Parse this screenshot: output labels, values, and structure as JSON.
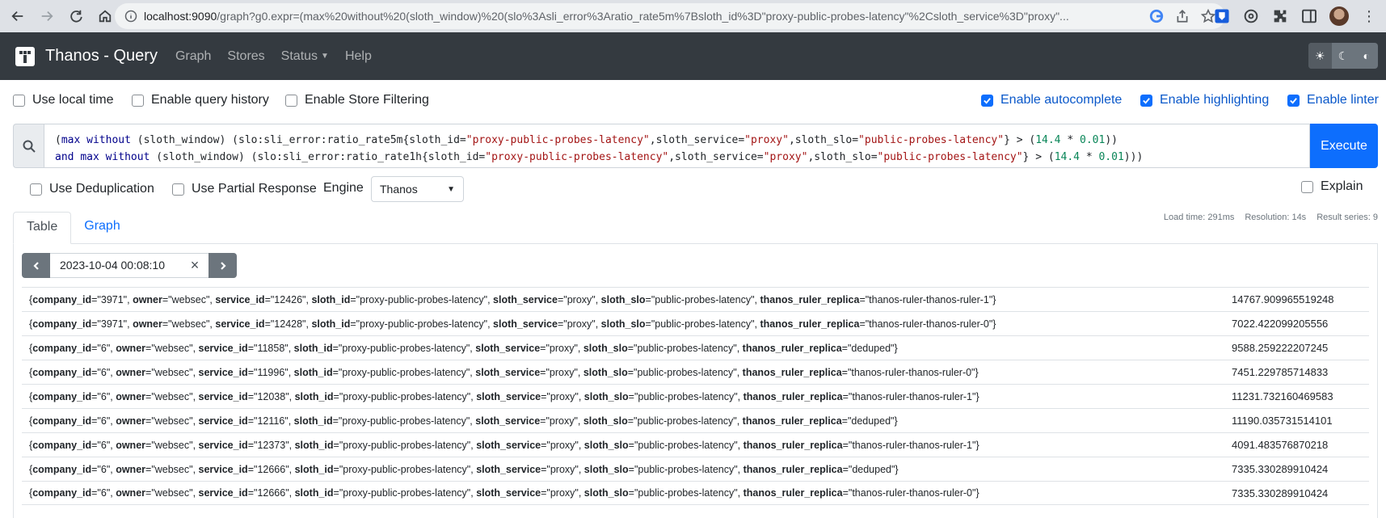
{
  "browser": {
    "url_host": "localhost:9090",
    "url_rest": "/graph?g0.expr=(max%20without%20(sloth_window)%20(slo%3Asli_error%3Aratio_rate5m%7Bsloth_id%3D\"proxy-public-probes-latency\"%2Csloth_service%3D\"proxy\"..."
  },
  "navbar": {
    "brand": "Thanos - Query",
    "links": [
      "Graph",
      "Stores",
      "Status",
      "Help"
    ]
  },
  "options": {
    "use_local_time": "Use local time",
    "enable_query_history": "Enable query history",
    "enable_store_filtering": "Enable Store Filtering",
    "enable_autocomplete": "Enable autocomplete",
    "enable_highlighting": "Enable highlighting",
    "enable_linter": "Enable linter"
  },
  "query": {
    "line1": "(max without (sloth_window) (slo:sli_error:ratio_rate5m{sloth_id=\"proxy-public-probes-latency\",sloth_service=\"proxy\",sloth_slo=\"public-probes-latency\"} > (14.4 * 0.01))",
    "line2": "and max without (sloth_window) (slo:sli_error:ratio_rate1h{sloth_id=\"proxy-public-probes-latency\",sloth_service=\"proxy\",sloth_slo=\"public-probes-latency\"} > (14.4 * 0.01)))",
    "execute_label": "Execute"
  },
  "row2": {
    "use_deduplication": "Use Deduplication",
    "use_partial_response": "Use Partial Response",
    "engine_label": "Engine",
    "engine_value": "Thanos",
    "explain": "Explain"
  },
  "tabs": {
    "table": "Table",
    "graph": "Graph"
  },
  "stats": {
    "load_time": "Load time: 291ms",
    "resolution": "Resolution: 14s",
    "result_series": "Result series: 9"
  },
  "time": {
    "value": "2023-10-04 00:08:10",
    "clear": "×"
  },
  "results": [
    {
      "labels": [
        [
          "company_id",
          "3971"
        ],
        [
          "owner",
          "websec"
        ],
        [
          "service_id",
          "12426"
        ],
        [
          "sloth_id",
          "proxy-public-probes-latency"
        ],
        [
          "sloth_service",
          "proxy"
        ],
        [
          "sloth_slo",
          "public-probes-latency"
        ],
        [
          "thanos_ruler_replica",
          "thanos-ruler-thanos-ruler-1"
        ]
      ],
      "value": "14767.909965519248"
    },
    {
      "labels": [
        [
          "company_id",
          "3971"
        ],
        [
          "owner",
          "websec"
        ],
        [
          "service_id",
          "12428"
        ],
        [
          "sloth_id",
          "proxy-public-probes-latency"
        ],
        [
          "sloth_service",
          "proxy"
        ],
        [
          "sloth_slo",
          "public-probes-latency"
        ],
        [
          "thanos_ruler_replica",
          "thanos-ruler-thanos-ruler-0"
        ]
      ],
      "value": "7022.422099205556"
    },
    {
      "labels": [
        [
          "company_id",
          "6"
        ],
        [
          "owner",
          "websec"
        ],
        [
          "service_id",
          "11858"
        ],
        [
          "sloth_id",
          "proxy-public-probes-latency"
        ],
        [
          "sloth_service",
          "proxy"
        ],
        [
          "sloth_slo",
          "public-probes-latency"
        ],
        [
          "thanos_ruler_replica",
          "deduped"
        ]
      ],
      "value": "9588.259222207245"
    },
    {
      "labels": [
        [
          "company_id",
          "6"
        ],
        [
          "owner",
          "websec"
        ],
        [
          "service_id",
          "11996"
        ],
        [
          "sloth_id",
          "proxy-public-probes-latency"
        ],
        [
          "sloth_service",
          "proxy"
        ],
        [
          "sloth_slo",
          "public-probes-latency"
        ],
        [
          "thanos_ruler_replica",
          "thanos-ruler-thanos-ruler-0"
        ]
      ],
      "value": "7451.229785714833"
    },
    {
      "labels": [
        [
          "company_id",
          "6"
        ],
        [
          "owner",
          "websec"
        ],
        [
          "service_id",
          "12038"
        ],
        [
          "sloth_id",
          "proxy-public-probes-latency"
        ],
        [
          "sloth_service",
          "proxy"
        ],
        [
          "sloth_slo",
          "public-probes-latency"
        ],
        [
          "thanos_ruler_replica",
          "thanos-ruler-thanos-ruler-1"
        ]
      ],
      "value": "11231.732160469583"
    },
    {
      "labels": [
        [
          "company_id",
          "6"
        ],
        [
          "owner",
          "websec"
        ],
        [
          "service_id",
          "12116"
        ],
        [
          "sloth_id",
          "proxy-public-probes-latency"
        ],
        [
          "sloth_service",
          "proxy"
        ],
        [
          "sloth_slo",
          "public-probes-latency"
        ],
        [
          "thanos_ruler_replica",
          "deduped"
        ]
      ],
      "value": "11190.035731514101"
    },
    {
      "labels": [
        [
          "company_id",
          "6"
        ],
        [
          "owner",
          "websec"
        ],
        [
          "service_id",
          "12373"
        ],
        [
          "sloth_id",
          "proxy-public-probes-latency"
        ],
        [
          "sloth_service",
          "proxy"
        ],
        [
          "sloth_slo",
          "public-probes-latency"
        ],
        [
          "thanos_ruler_replica",
          "thanos-ruler-thanos-ruler-1"
        ]
      ],
      "value": "4091.483576870218"
    },
    {
      "labels": [
        [
          "company_id",
          "6"
        ],
        [
          "owner",
          "websec"
        ],
        [
          "service_id",
          "12666"
        ],
        [
          "sloth_id",
          "proxy-public-probes-latency"
        ],
        [
          "sloth_service",
          "proxy"
        ],
        [
          "sloth_slo",
          "public-probes-latency"
        ],
        [
          "thanos_ruler_replica",
          "deduped"
        ]
      ],
      "value": "7335.330289910424"
    },
    {
      "labels": [
        [
          "company_id",
          "6"
        ],
        [
          "owner",
          "websec"
        ],
        [
          "service_id",
          "12666"
        ],
        [
          "sloth_id",
          "proxy-public-probes-latency"
        ],
        [
          "sloth_service",
          "proxy"
        ],
        [
          "sloth_slo",
          "public-probes-latency"
        ],
        [
          "thanos_ruler_replica",
          "thanos-ruler-thanos-ruler-0"
        ]
      ],
      "value": "7335.330289910424"
    }
  ],
  "colors": {
    "navbar_bg": "#343a40",
    "primary": "#0d6efd",
    "secondary": "#6c757d"
  }
}
